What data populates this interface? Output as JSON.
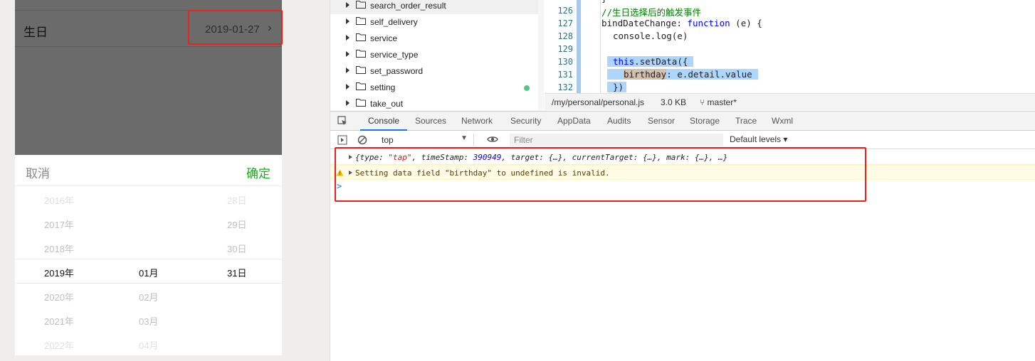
{
  "simulator": {
    "birthday_label": "生日",
    "birthday_value": "2019-01-27",
    "picker": {
      "cancel_label": "取消",
      "confirm_label": "确定",
      "years": [
        "2016年",
        "2017年",
        "2018年",
        "2019年",
        "2020年",
        "2021年",
        "2022年"
      ],
      "months": [
        "01月",
        "02月",
        "03月",
        "04月"
      ],
      "days": [
        "28日",
        "29日",
        "30日",
        "31日"
      ],
      "selected": {
        "year": "2019年",
        "month": "01月",
        "day": "31日"
      }
    }
  },
  "file_tree": {
    "items": [
      {
        "label": "search_order_result"
      },
      {
        "label": "self_delivery"
      },
      {
        "label": "service"
      },
      {
        "label": "service_type"
      },
      {
        "label": "set_password"
      },
      {
        "label": "setting"
      },
      {
        "label": "take_out"
      }
    ]
  },
  "editor": {
    "line_numbers": [
      "126",
      "127",
      "128",
      "129",
      "130",
      "131",
      "132"
    ],
    "lines": {
      "l125": "}",
      "l126": "//生日选择后的触发事件",
      "l127_name": "bindDateChange",
      "l127_colon": ": ",
      "l127_kw": "function",
      "l127_rest": " (e) {",
      "l128": "console.log(e)",
      "l130_kw": "this",
      "l130_rest": ".setData({",
      "l131_key": "birthday",
      "l131_rest": ": e.detail.value",
      "l132": "})"
    }
  },
  "statusbar": {
    "file_path": "/my/personal/personal.js",
    "file_size": "3.0 KB",
    "branch": "master*"
  },
  "devtools_tabs": [
    "Console",
    "Sources",
    "Network",
    "Security",
    "AppData",
    "Audits",
    "Sensor",
    "Storage",
    "Trace",
    "Wxml"
  ],
  "console": {
    "context": "top",
    "filter_placeholder": "Filter",
    "levels_label": "Default levels",
    "log_parts": {
      "a": "{type: ",
      "type_val": "\"tap\"",
      "b": ", timeStamp: ",
      "ts_val": "390949",
      "c": ", target: {…}, currentTarget: {…}, mark: {…}, …}"
    },
    "warning_text": "Setting data field \"birthday\" to undefined is invalid.",
    "prompt": ">"
  },
  "colors": {
    "confirm_green": "#1aad19",
    "annotation_red": "#e8231c",
    "tab_active_blue": "#1a73e8"
  }
}
